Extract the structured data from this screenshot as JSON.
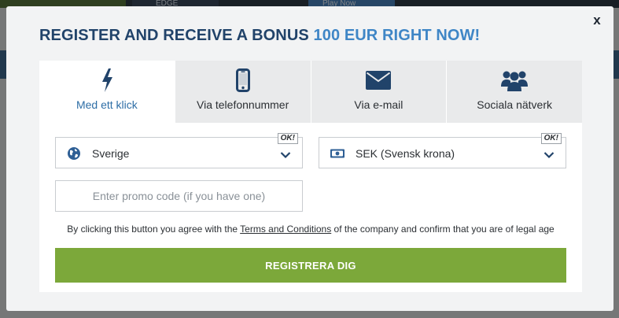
{
  "background": {
    "banner_edge_text": "EDGE",
    "banner_play_text": "Play Now"
  },
  "modal": {
    "close_label": "x",
    "title_main": "REGISTER AND RECEIVE A BONUS ",
    "title_highlight": "100 EUR RIGHT NOW!",
    "tabs": [
      {
        "label": "Med ett klick",
        "icon": "lightning-icon",
        "active": true
      },
      {
        "label": "Via telefonnummer",
        "icon": "phone-icon",
        "active": false
      },
      {
        "label": "Via e-mail",
        "icon": "envelope-icon",
        "active": false
      },
      {
        "label": "Sociala nätverk",
        "icon": "users-icon",
        "active": false
      }
    ],
    "country_select": {
      "value": "Sverige",
      "icon": "globe-icon",
      "badge": "OK!"
    },
    "currency_select": {
      "value": "SEK (Svensk krona)",
      "icon": "banknote-icon",
      "badge": "OK!"
    },
    "promo": {
      "placeholder": "Enter promo code (if you have one)",
      "value": ""
    },
    "agreement": {
      "before": "By clicking this button you agree with the ",
      "link": "Terms and Conditions",
      "after": " of the company and confirm that you are of legal age"
    },
    "register_label": "REGISTRERA DIG"
  },
  "colors": {
    "title": "#21436a",
    "accent": "#3f86c6",
    "icon": "#21436a",
    "active_tab_text": "#2e6ea6",
    "button_green": "#7ca83a",
    "modal_bg": "#f2f3f4"
  }
}
